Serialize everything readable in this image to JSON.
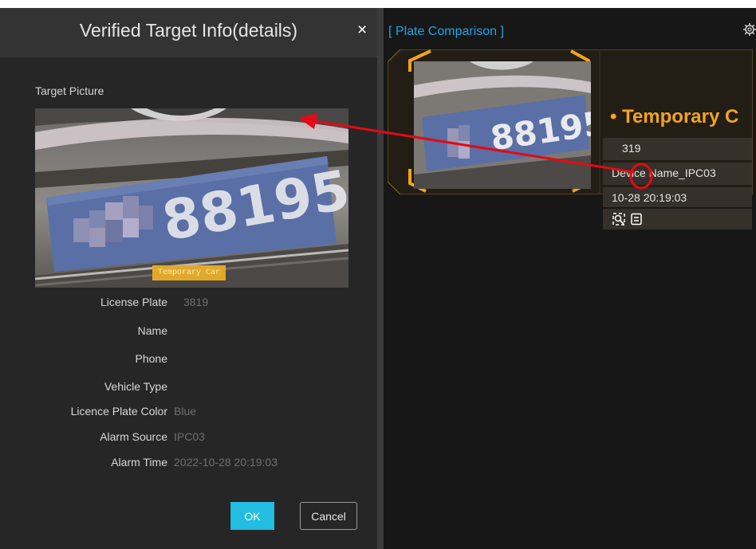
{
  "dialog": {
    "title": "Verified Target Info(details)",
    "close_glyph": "×",
    "section_label": "Target Picture",
    "picture_tag": "Temporary Car",
    "fields": [
      {
        "label": "License Plate",
        "value": "3819"
      },
      {
        "label": "Name",
        "value": ""
      },
      {
        "label": "Phone",
        "value": ""
      },
      {
        "label": "Vehicle Type",
        "value": ""
      },
      {
        "label": "Licence Plate Color",
        "value": "Blue"
      },
      {
        "label": "Alarm Source",
        "value": "IPC03"
      },
      {
        "label": "Alarm Time",
        "value": "2022-10-28 20:19:03"
      }
    ],
    "ok_label": "OK",
    "cancel_label": "Cancel"
  },
  "panel": {
    "title": "[ Plate Comparison ]",
    "settings_icon": "gear-icon",
    "card": {
      "name": "• Temporary C",
      "plate": "319",
      "device": "Device Name_IPC03",
      "time": "10-28 20:19:03",
      "icons": [
        "search-icon",
        "details-icon"
      ]
    },
    "plate_text": "88195"
  },
  "colors": {
    "accent": "#22bde0",
    "panel_title": "#1ea5e6",
    "card_gold": "#f2a31f",
    "annotation": "#e50914"
  }
}
